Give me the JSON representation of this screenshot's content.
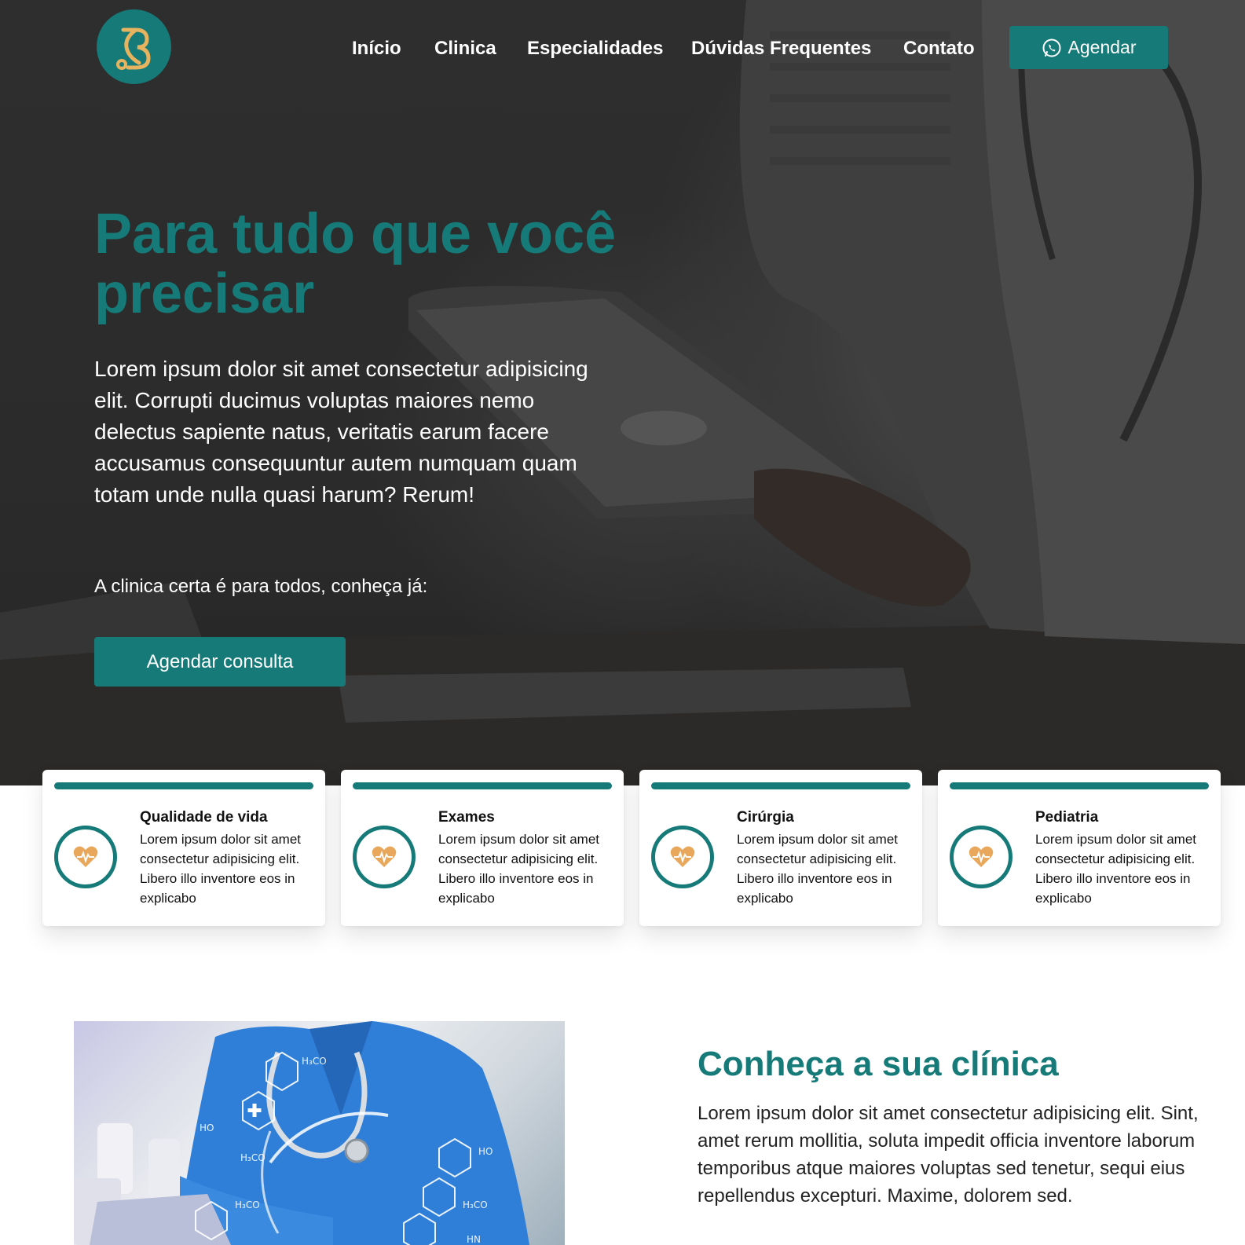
{
  "nav": {
    "items": [
      {
        "label": "Início"
      },
      {
        "label": "Clinica"
      },
      {
        "label": "Especialidades"
      },
      {
        "label": "Dúvidas Frequentes"
      },
      {
        "label": "Contato"
      }
    ],
    "cta_label": "Agendar"
  },
  "hero": {
    "title_line1": "Para tudo que você",
    "title_line2": "precisar",
    "text": "Lorem ipsum dolor sit amet consectetur adipisicing elit. Corrupti ducimus voluptas maiores nemo delectus sapiente natus, veritatis earum facere accusamus consequuntur autem numquam quam totam unde nulla quasi harum? Rerum!",
    "subtext": "A clinica certa é para todos, conheça já:",
    "cta_label": "Agendar consulta"
  },
  "cards": [
    {
      "title": "Qualidade de vida",
      "text": "Lorem ipsum dolor sit amet consectetur adipisicing elit. Libero illo inventore eos in explicabo"
    },
    {
      "title": "Exames",
      "text": "Lorem ipsum dolor sit amet consectetur adipisicing elit. Libero illo inventore eos in explicabo"
    },
    {
      "title": "Cirúrgia",
      "text": "Lorem ipsum dolor sit amet consectetur adipisicing elit. Libero illo inventore eos in explicabo"
    },
    {
      "title": "Pediatria",
      "text": "Lorem ipsum dolor sit amet consectetur adipisicing elit. Libero illo inventore eos in explicabo"
    }
  ],
  "about": {
    "title": "Conheça a sua clínica",
    "text": "Lorem ipsum dolor sit amet consectetur adipisicing elit. Sint, amet rerum mollitia, soluta impedit officia inventore laborum temporibus atque maiores voluptas sed tenetur, sequi eius repellendus excepturi. Maxime, dolorem sed."
  },
  "icons": {
    "logo": "logo-mark",
    "nav_cta": "whatsapp-icon",
    "card": "heart-pulse-icon"
  },
  "colors": {
    "primary": "#157a78",
    "accent": "#e8a75a",
    "hero_overlay": "#2b2b2b"
  }
}
